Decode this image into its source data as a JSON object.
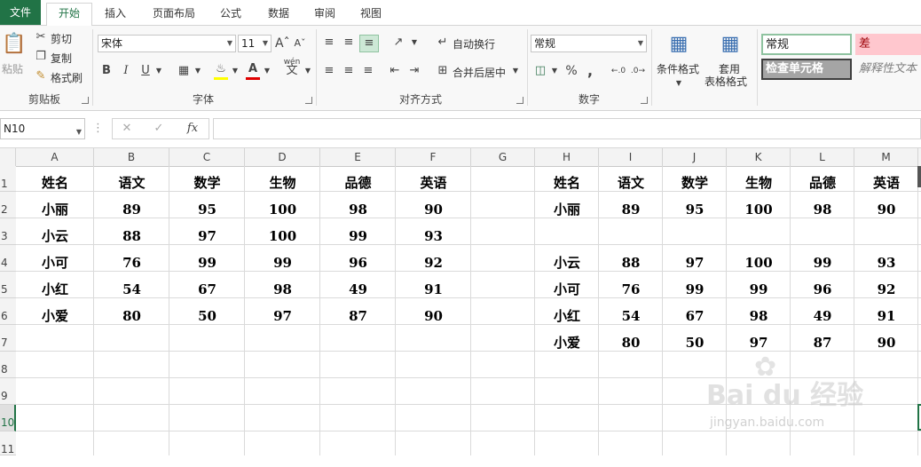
{
  "tabs": [
    "文件",
    "开始",
    "插入",
    "页面布局",
    "公式",
    "数据",
    "审阅",
    "视图"
  ],
  "clipboard": {
    "paste": "粘贴",
    "cut": "剪切",
    "copy": "复制",
    "format_painter": "格式刷",
    "group": "剪贴板"
  },
  "font": {
    "name": "宋体",
    "size": "11",
    "bold": "B",
    "italic": "I",
    "underline": "U",
    "group": "字体",
    "wen": "wén",
    "wen2": "文"
  },
  "alignment": {
    "wrap": "自动换行",
    "merge": "合并后居中",
    "group": "对齐方式"
  },
  "number": {
    "format": "常规",
    "percent": "%",
    "comma": ",",
    "group": "数字"
  },
  "styles": {
    "conditional": "条件格式",
    "table_format_1": "套用",
    "table_format_2": "表格格式",
    "normal": "常规",
    "bad": "差",
    "check_cell": "检查单元格",
    "explanatory": "解释性文本"
  },
  "formula_bar": {
    "name_box": "N10",
    "fx": "fx",
    "value": ""
  },
  "columns": [
    "A",
    "B",
    "C",
    "D",
    "E",
    "F",
    "G",
    "H",
    "I",
    "J",
    "K",
    "L",
    "M"
  ],
  "rows": [
    "1",
    "2",
    "3",
    "4",
    "5",
    "6",
    "7",
    "8",
    "9",
    "10",
    "11"
  ],
  "left_table": [
    [
      "姓名",
      "语文",
      "数学",
      "生物",
      "品德",
      "英语"
    ],
    [
      "小丽",
      "89",
      "95",
      "100",
      "98",
      "90"
    ],
    [
      "小云",
      "88",
      "97",
      "100",
      "99",
      "93"
    ],
    [
      "小可",
      "76",
      "99",
      "99",
      "96",
      "92"
    ],
    [
      "小红",
      "54",
      "67",
      "98",
      "49",
      "91"
    ],
    [
      "小爱",
      "80",
      "50",
      "97",
      "87",
      "90"
    ]
  ],
  "right_table": [
    [
      "姓名",
      "语文",
      "数学",
      "生物",
      "品德",
      "英语"
    ],
    [
      "小丽",
      "89",
      "95",
      "100",
      "98",
      "90"
    ],
    [
      "",
      "",
      "",
      "",
      "",
      ""
    ],
    [
      "小云",
      "88",
      "97",
      "100",
      "99",
      "93"
    ],
    [
      "小可",
      "76",
      "99",
      "99",
      "96",
      "92"
    ],
    [
      "小红",
      "54",
      "67",
      "98",
      "49",
      "91"
    ],
    [
      "小爱",
      "80",
      "50",
      "97",
      "87",
      "90"
    ]
  ],
  "watermark": {
    "brand": "Bai du 经验",
    "url": "jingyan.baidu.com"
  },
  "colors": {
    "excel_green": "#217346",
    "bad_fill": "#ffc7ce",
    "check_fill": "#a5a5a5"
  }
}
